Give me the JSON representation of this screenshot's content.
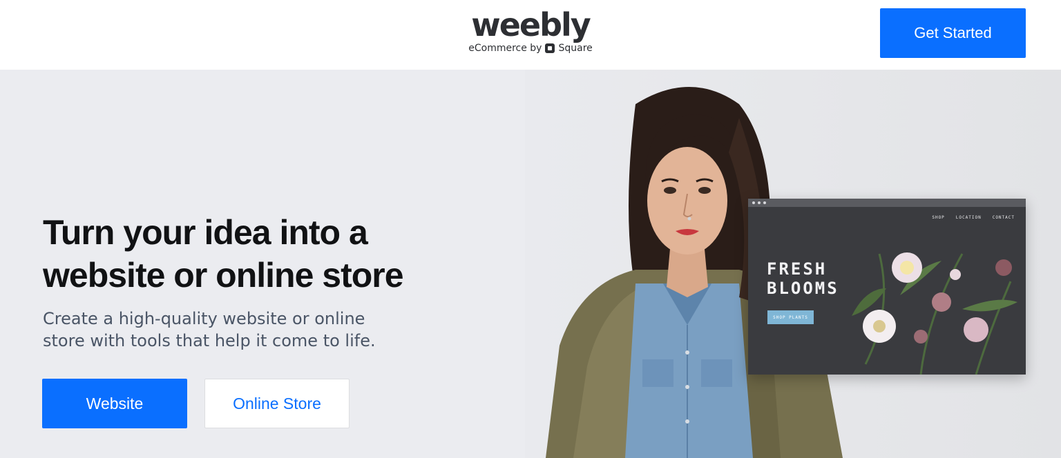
{
  "header": {
    "logo_word": "weebly",
    "logo_sub_prefix": "eCommerce by",
    "logo_sub_brand": "Square",
    "get_started_label": "Get Started"
  },
  "hero": {
    "title": "Turn your idea into a website or online store",
    "subtitle": "Create a high-quality website or online store with tools that help it come to life.",
    "website_button": "Website",
    "online_store_button": "Online Store"
  },
  "mockup": {
    "nav": [
      "SHOP",
      "LOCATION",
      "CONTACT"
    ],
    "title": "FRESH BLOOMS",
    "button": "SHOP PLANTS"
  },
  "colors": {
    "accent": "#0a6fff",
    "hero_bg": "#ebecf0",
    "text_dark": "#111214",
    "text_sub": "#4a5566"
  },
  "icons": {
    "brand_mark": "square-logo-icon"
  }
}
